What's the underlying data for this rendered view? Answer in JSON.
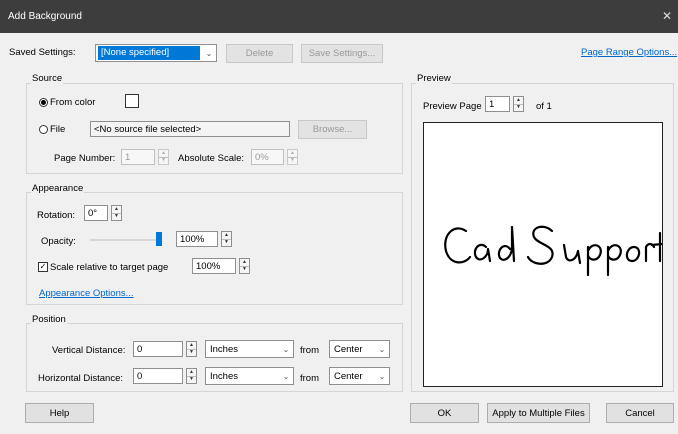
{
  "window": {
    "title": "Add Background",
    "close_glyph": "✕"
  },
  "saved_settings": {
    "label": "Saved Settings:",
    "value": "[None specified]",
    "delete_label": "Delete",
    "save_label": "Save Settings...",
    "page_range_link": "Page Range Options..."
  },
  "source": {
    "group_label": "Source",
    "from_color_label": "From color",
    "file_label": "File",
    "file_value": "<No source file selected>",
    "browse_label": "Browse...",
    "page_number_label": "Page Number:",
    "page_number_value": "1",
    "absolute_scale_label": "Absolute Scale:",
    "absolute_scale_value": "0%"
  },
  "appearance": {
    "group_label": "Appearance",
    "rotation_label": "Rotation:",
    "rotation_value": "0°",
    "opacity_label": "Opacity:",
    "opacity_value": "100%",
    "opacity_level": 1.0,
    "scale_label": "Scale relative to target page",
    "scale_checked": true,
    "scale_value": "100%",
    "options_link": "Appearance Options..."
  },
  "position": {
    "group_label": "Position",
    "vertical_label": "Vertical Distance:",
    "vertical_value": "0",
    "vertical_units": "Inches",
    "vertical_from_label": "from",
    "vertical_from_value": "Center",
    "horizontal_label": "Horizontal Distance:",
    "horizontal_value": "0",
    "horizontal_units": "Inches",
    "horizontal_from_label": "from",
    "horizontal_from_value": "Center"
  },
  "preview": {
    "group_label": "Preview",
    "page_label": "Preview Page",
    "page_value": "1",
    "of_label": "of 1",
    "content_text": "Cad Support"
  },
  "buttons": {
    "help": "Help",
    "ok": "OK",
    "apply_multiple": "Apply to Multiple Files",
    "cancel": "Cancel"
  },
  "icons": {
    "chevron": "⌄",
    "spin_up": "▲",
    "spin_down": "▼",
    "check": "✓"
  },
  "colors": {
    "titlebar": "#3d3d3d",
    "accent": "#0078d7",
    "link": "#0066cc"
  }
}
